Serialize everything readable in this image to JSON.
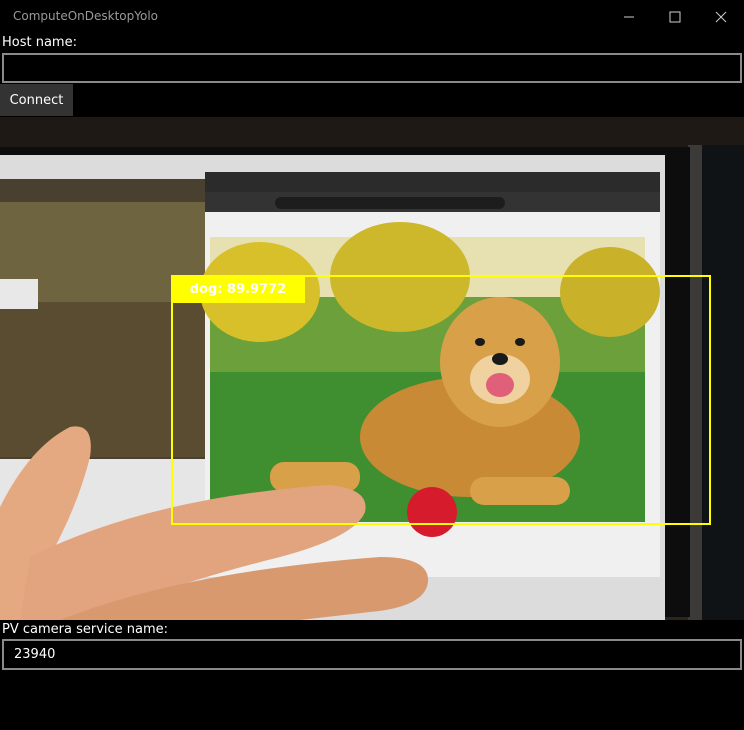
{
  "window": {
    "title": "ComputeOnDesktopYolo"
  },
  "host": {
    "label": "Host name:",
    "value": ""
  },
  "connect": {
    "label": "Connect"
  },
  "detection": {
    "label": "dog: 89.9772"
  },
  "pv_camera": {
    "label": "PV camera service name:",
    "value": "23940"
  },
  "colors": {
    "bbox": "#ffff00",
    "background": "#000000",
    "button": "#333333"
  }
}
